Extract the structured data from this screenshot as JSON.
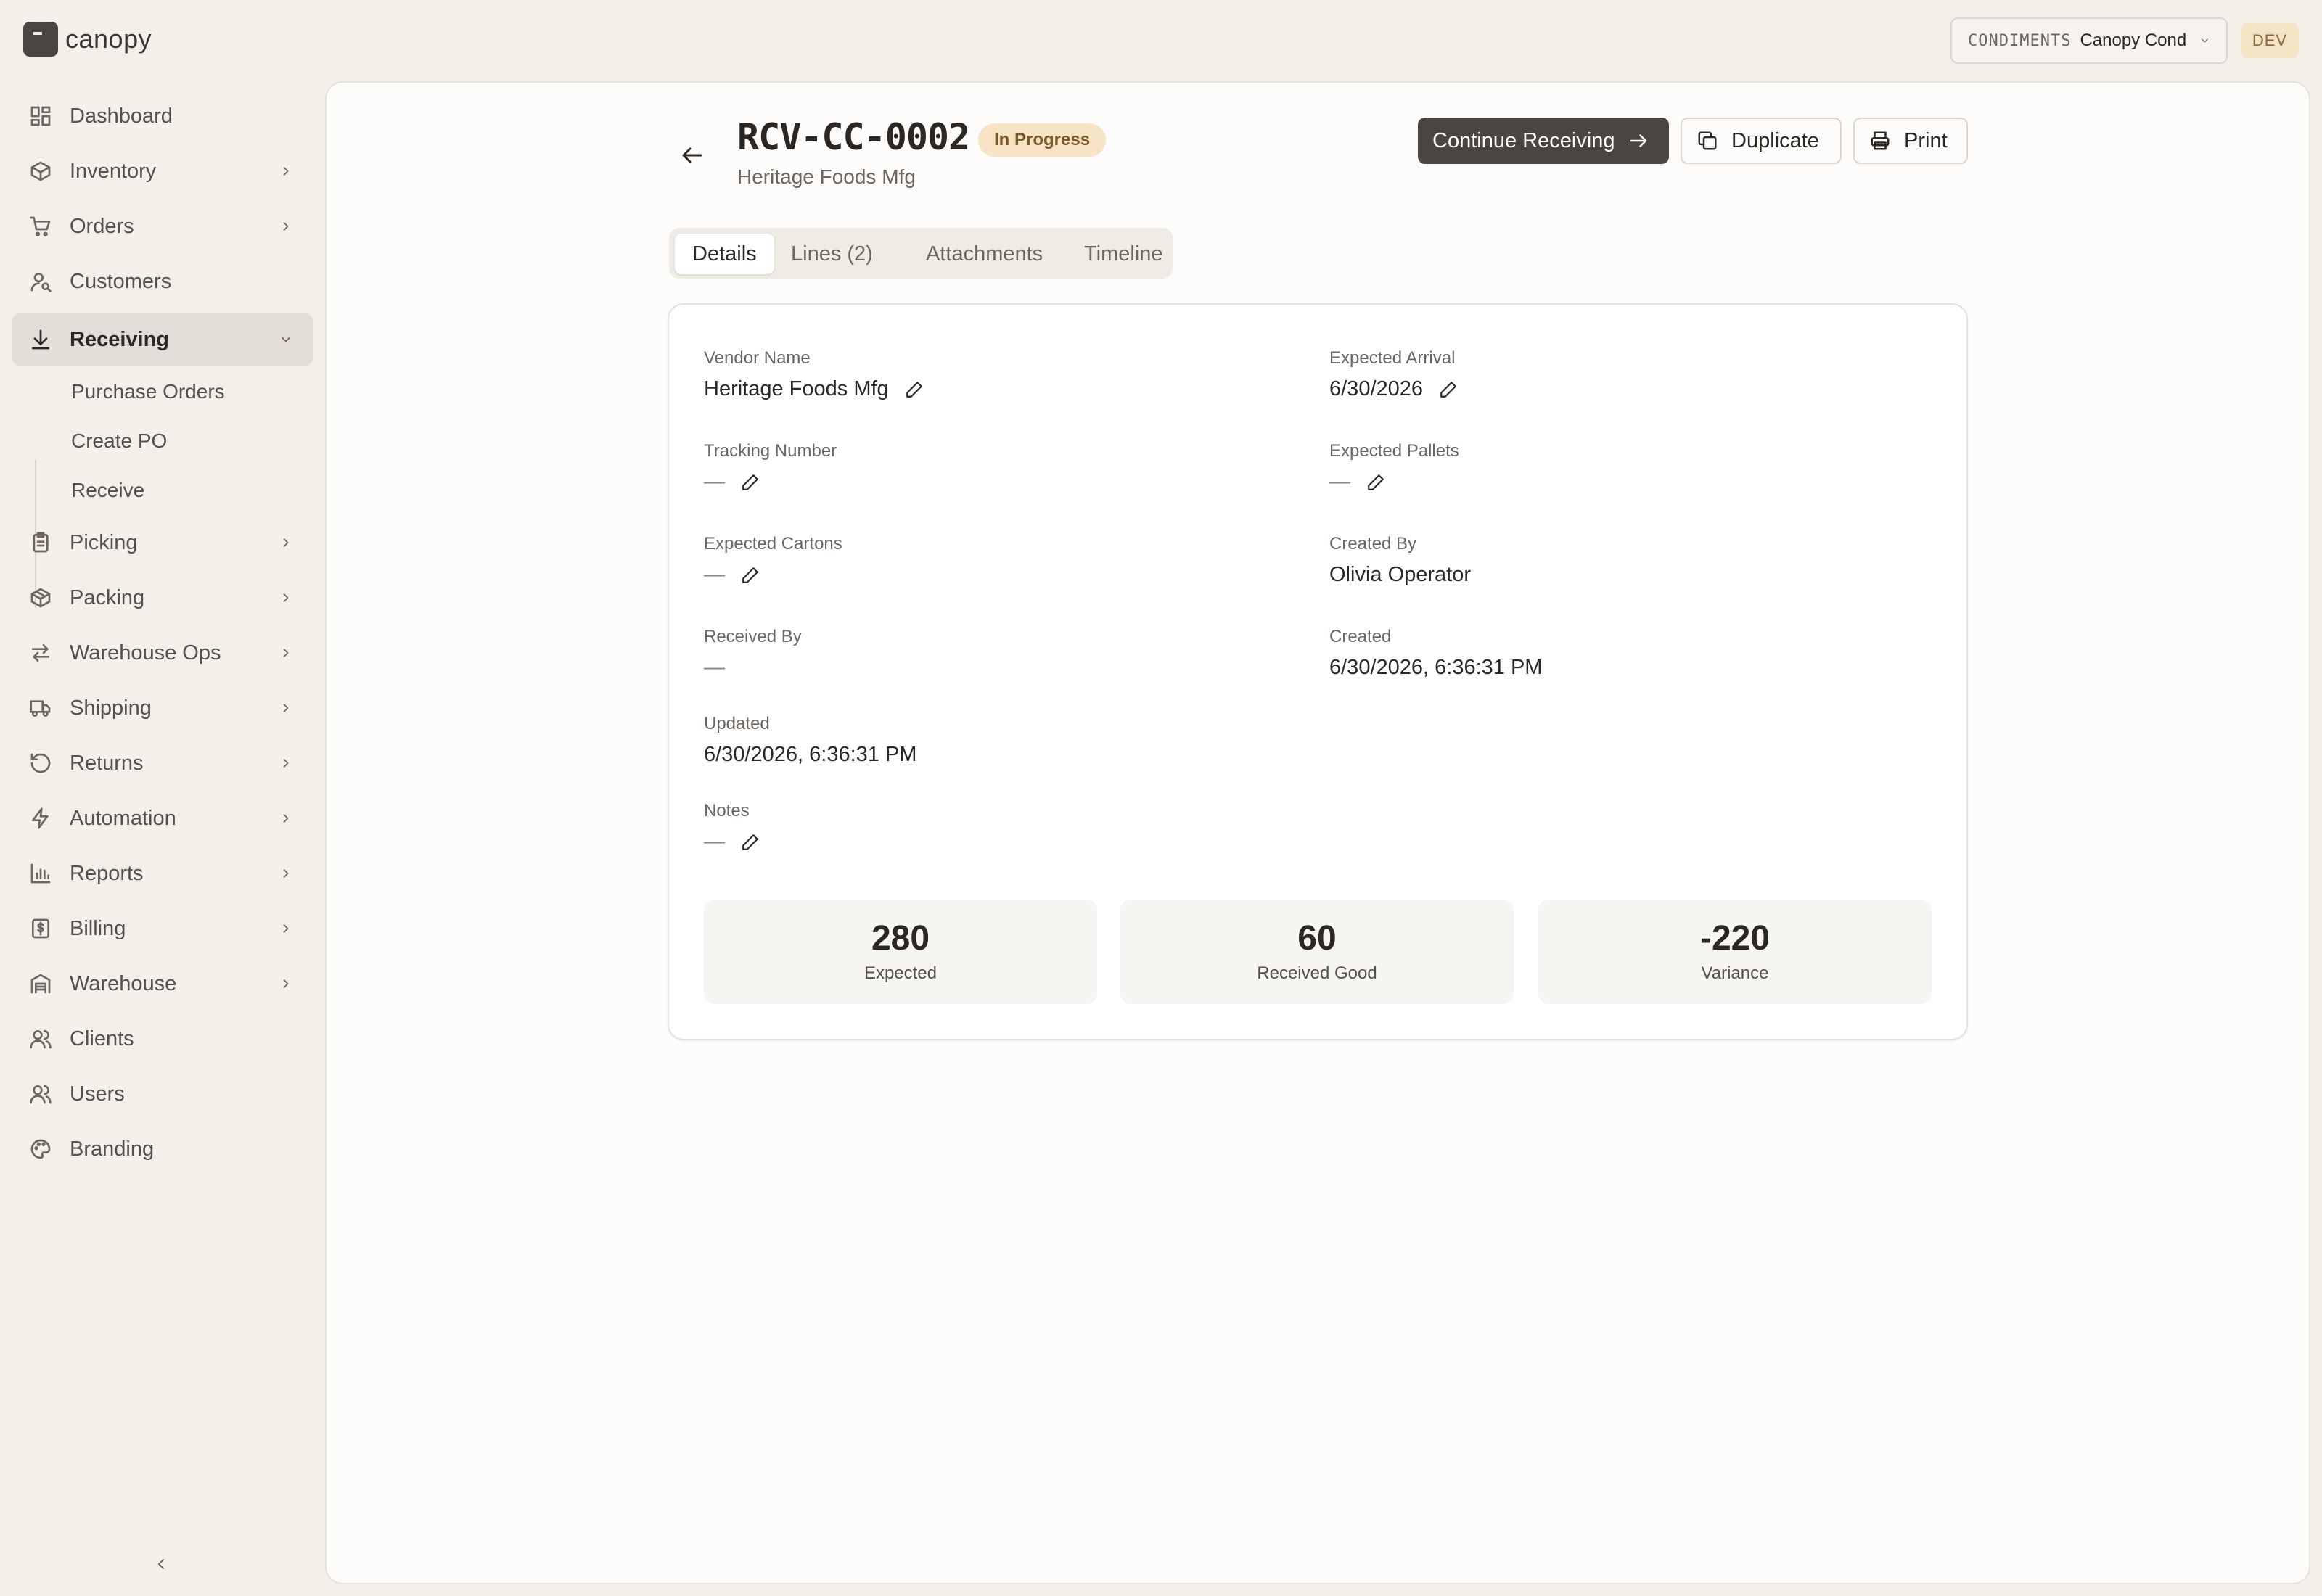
{
  "app": {
    "name": "canopy"
  },
  "tenant": {
    "code": "CONDIMENTS",
    "name": "Canopy Cond",
    "env": "DEV"
  },
  "sidebar": {
    "items": [
      {
        "label": "Dashboard",
        "icon": "dashboard-icon",
        "has_children": false
      },
      {
        "label": "Inventory",
        "icon": "box-icon",
        "has_children": true
      },
      {
        "label": "Orders",
        "icon": "cart-icon",
        "has_children": true
      },
      {
        "label": "Customers",
        "icon": "customer-icon",
        "has_children": false
      },
      {
        "label": "Receiving",
        "icon": "download-icon",
        "has_children": true,
        "active": true,
        "expanded": true
      },
      {
        "label": "Picking",
        "icon": "clipboard-icon",
        "has_children": true
      },
      {
        "label": "Packing",
        "icon": "package-icon",
        "has_children": true
      },
      {
        "label": "Warehouse Ops",
        "icon": "transfer-icon",
        "has_children": true
      },
      {
        "label": "Shipping",
        "icon": "truck-icon",
        "has_children": true
      },
      {
        "label": "Returns",
        "icon": "return-icon",
        "has_children": true
      },
      {
        "label": "Automation",
        "icon": "bolt-icon",
        "has_children": true
      },
      {
        "label": "Reports",
        "icon": "bar-chart-icon",
        "has_children": true
      },
      {
        "label": "Billing",
        "icon": "receipt-icon",
        "has_children": true
      },
      {
        "label": "Warehouse",
        "icon": "warehouse-icon",
        "has_children": true
      },
      {
        "label": "Clients",
        "icon": "users-icon",
        "has_children": false
      },
      {
        "label": "Users",
        "icon": "users-icon",
        "has_children": false
      },
      {
        "label": "Branding",
        "icon": "palette-icon",
        "has_children": false
      }
    ],
    "receiving_sub": [
      "Purchase Orders",
      "Create PO",
      "Receive"
    ]
  },
  "header": {
    "record_id": "RCV-CC-0002",
    "status": "In Progress",
    "subtitle": "Heritage Foods Mfg",
    "continue_label": "Continue Receiving",
    "duplicate_label": "Duplicate",
    "print_label": "Print"
  },
  "tabs": [
    "Details",
    "Lines (2)",
    "Attachments",
    "Timeline"
  ],
  "details": {
    "vendor_name": {
      "label": "Vendor Name",
      "value": "Heritage Foods Mfg"
    },
    "expected_arrival": {
      "label": "Expected Arrival",
      "value": "6/30/2026"
    },
    "tracking_number": {
      "label": "Tracking Number",
      "value": "—"
    },
    "expected_pallets": {
      "label": "Expected Pallets",
      "value": "—"
    },
    "expected_cartons": {
      "label": "Expected Cartons",
      "value": "—"
    },
    "created_by": {
      "label": "Created By",
      "value": "Olivia Operator"
    },
    "received_by": {
      "label": "Received By",
      "value": "—"
    },
    "created": {
      "label": "Created",
      "value": "6/30/2026, 6:36:31 PM"
    },
    "updated": {
      "label": "Updated",
      "value": "6/30/2026, 6:36:31 PM"
    },
    "notes": {
      "label": "Notes",
      "value": "—"
    }
  },
  "stats": [
    {
      "value": "280",
      "label": "Expected"
    },
    {
      "value": "60",
      "label": "Received Good"
    },
    {
      "value": "-220",
      "label": "Variance"
    }
  ],
  "colors": {
    "accent": "#4a4541",
    "background": "#f3efe9",
    "status_badge": "#f7e4c7",
    "env_badge": "#f5e3c5"
  }
}
